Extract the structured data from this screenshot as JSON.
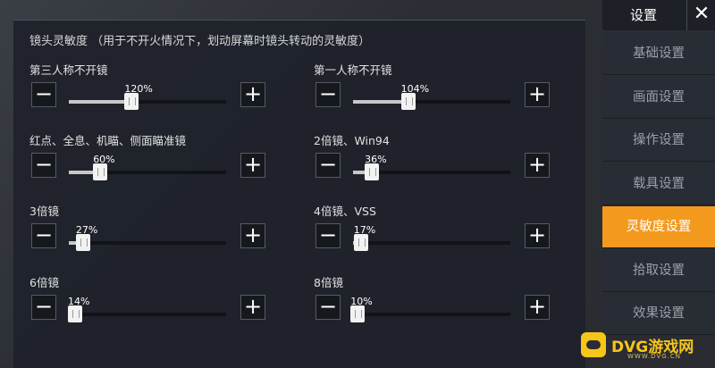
{
  "panel": {
    "title": "镜头灵敏度 （用于不开火情况下，划动屏幕时镜头转动的灵敏度）",
    "settings": [
      {
        "label": "第三人称不开镜",
        "value_text": "120%",
        "fraction": 0.4
      },
      {
        "label": "第一人称不开镜",
        "value_text": "104%",
        "fraction": 0.35
      },
      {
        "label": "红点、全息、机瞄、侧面瞄准镜",
        "value_text": "60%",
        "fraction": 0.2
      },
      {
        "label": "2倍镜、Win94",
        "value_text": "36%",
        "fraction": 0.12
      },
      {
        "label": "3倍镜",
        "value_text": "27%",
        "fraction": 0.09
      },
      {
        "label": "4倍镜、VSS",
        "value_text": "17%",
        "fraction": 0.05
      },
      {
        "label": "6倍镜",
        "value_text": "14%",
        "fraction": 0.04
      },
      {
        "label": "8倍镜",
        "value_text": "10%",
        "fraction": 0.03
      }
    ],
    "minus_label": "−",
    "plus_label": "+"
  },
  "sidebar": {
    "title": "设置",
    "close_label": "✕",
    "items": [
      {
        "label": "基础设置",
        "active": false
      },
      {
        "label": "画面设置",
        "active": false
      },
      {
        "label": "操作设置",
        "active": false
      },
      {
        "label": "载具设置",
        "active": false
      },
      {
        "label": "灵敏度设置",
        "active": true
      },
      {
        "label": "拾取设置",
        "active": false
      },
      {
        "label": "效果设置",
        "active": false
      }
    ]
  },
  "watermark": {
    "text": "DVG游戏网",
    "sub": "WWW.DVG.CN"
  },
  "colors": {
    "accent": "#f39a1e",
    "watermark": "#f6c51a"
  }
}
